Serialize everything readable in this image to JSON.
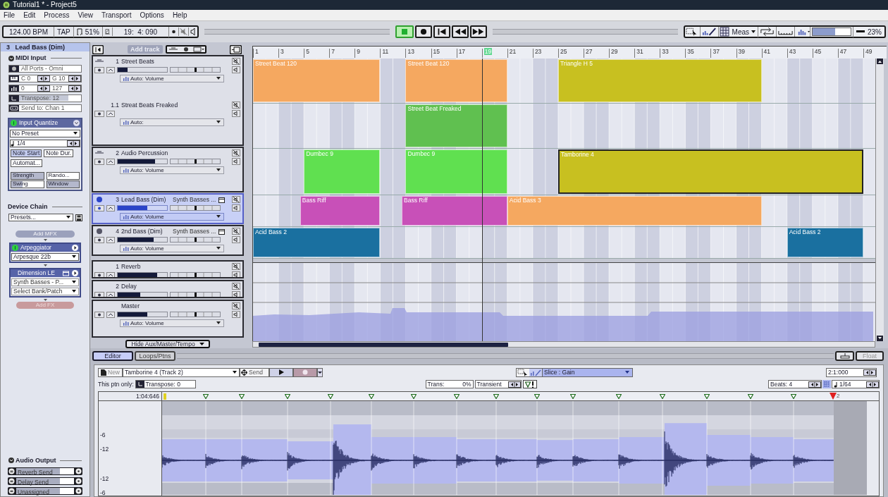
{
  "window": {
    "title": "Tutorial1 * - Project5"
  },
  "menu": [
    "File",
    "Edit",
    "Process",
    "View",
    "Transport",
    "Options",
    "Help"
  ],
  "transport": {
    "tempo": "124.00 BPM",
    "tap": "TAP",
    "swing": "51%",
    "position": "19:  4: 090",
    "buttons": [
      {
        "kind": "stop",
        "active": true
      },
      {
        "kind": "record",
        "active": false
      },
      {
        "kind": "to-start",
        "active": false
      },
      {
        "kind": "rewind",
        "active": false
      },
      {
        "kind": "forward",
        "active": false
      }
    ]
  },
  "tools": {
    "snap": "Meas",
    "zoom_slider": {
      "level": 0.6
    },
    "zoom": "23%"
  },
  "inspector": {
    "track_title": "3   Lead Bass (Dim)",
    "midi_input": {
      "heading": "MIDI Input",
      "port": "All Ports - Omni",
      "key_low": "C 0",
      "key_high": "G 10",
      "vel_low": "0",
      "vel_high": "127",
      "transpose": "Transpose: 12",
      "send_to": "Send to: Chan 1"
    },
    "quantize": {
      "title": "Input Quantize",
      "preset": "No Preset",
      "grid": "1/4",
      "buttons": [
        {
          "label": "Note Start",
          "selected": true
        },
        {
          "label": "Note Dur.",
          "selected": false
        },
        {
          "label": "Automat...",
          "selected": false
        }
      ],
      "params": [
        {
          "label": "Strength",
          "level": 1
        },
        {
          "label": "Rando...",
          "level": 0
        },
        {
          "label": "Swing",
          "level": 0.35
        },
        {
          "label": "Window",
          "level": 1
        }
      ]
    },
    "device_chain": {
      "heading": "Device Chain",
      "presets": "Presets...",
      "add_mfx": "Add MFX",
      "devices": [
        {
          "kind": "mfx",
          "name": "Arpeggiator",
          "rows": [
            "Arpesque 22b"
          ]
        },
        {
          "kind": "synth",
          "name": "Dimension LE",
          "rows": [
            "Synth Basses - P...",
            "Select Bank/Patch"
          ]
        }
      ],
      "add_fx": "Add FX"
    },
    "audio_output": {
      "heading": "Audio Output",
      "sends": [
        {
          "label": "Reverb Send",
          "level": 0.75
        },
        {
          "label": "Delay Send",
          "level": 0.75
        },
        {
          "label": "Unassigned",
          "level": 0.75
        }
      ]
    }
  },
  "track_header": {
    "add_track": "Add track"
  },
  "ruler": [
    {
      "label": "1",
      "selected": false
    },
    {
      "label": "3",
      "selected": false
    },
    {
      "label": "5",
      "selected": false
    },
    {
      "label": "7",
      "selected": false
    },
    {
      "label": "9",
      "selected": false
    },
    {
      "label": "11",
      "selected": false
    },
    {
      "label": "13",
      "selected": false
    },
    {
      "label": "15",
      "selected": false
    },
    {
      "label": "17",
      "selected": false
    },
    {
      "label": "19",
      "selected": true
    },
    {
      "label": "21",
      "selected": false
    },
    {
      "label": "23",
      "selected": false
    },
    {
      "label": "25",
      "selected": false
    },
    {
      "label": "27",
      "selected": false
    },
    {
      "label": "29",
      "selected": false
    },
    {
      "label": "31",
      "selected": false
    },
    {
      "label": "33",
      "selected": false
    },
    {
      "label": "35",
      "selected": false
    },
    {
      "label": "37",
      "selected": false
    },
    {
      "label": "39",
      "selected": false
    },
    {
      "label": "41",
      "selected": false
    },
    {
      "label": "43",
      "selected": false
    },
    {
      "label": "45",
      "selected": false
    },
    {
      "label": "47",
      "selected": false
    },
    {
      "label": "49",
      "selected": false
    }
  ],
  "tracks": [
    {
      "kind": "audio",
      "number": "1",
      "name": "Street Beats",
      "level": 0.2,
      "automation": "Auto: Volume",
      "selected": false,
      "pan": {
        "level": 0.5
      },
      "clips": [
        {
          "name": "Street Beat 120",
          "color": "#f5a860",
          "selected": false
        },
        {
          "name": "Street Beat 120",
          "color": "#f5a860",
          "selected": false
        },
        {
          "name": "Triangle H 5",
          "color": "#c8c020",
          "selected": false
        }
      ]
    },
    {
      "kind": "sub",
      "number": "1.1",
      "name": "Streat Beats Freaked",
      "automation": "Auto:",
      "selected": false,
      "clips": [
        {
          "name": "Street Beat Freaked",
          "color": "#60c050",
          "selected": false
        }
      ]
    },
    {
      "kind": "audio",
      "number": "2",
      "name": "Audio Percussion",
      "level": 0.75,
      "automation": "Auto: Volume",
      "selected": false,
      "pan": {
        "level": 0.5
      },
      "clips": [
        {
          "name": "Dumbec 9",
          "color": "#60e050",
          "selected": false
        },
        {
          "name": "Dumbec 9",
          "color": "#60e050",
          "selected": false
        },
        {
          "name": "Tamborine 4",
          "color": "#c8c020",
          "selected": true
        }
      ]
    },
    {
      "kind": "instrument",
      "number": "3",
      "name": "Lead Bass (Dim)",
      "instrument": "Synth Basses ...",
      "level": 0.6,
      "automation": "Auto: Volume",
      "selected": true,
      "pan": {
        "level": 0.5
      },
      "clips": [
        {
          "name": "Bass Riff",
          "color": "#c850b8",
          "selected": false
        },
        {
          "name": "Bass Riff",
          "color": "#c850b8",
          "selected": false
        },
        {
          "name": "Acid Bass 3",
          "color": "#f5a860",
          "selected": false
        }
      ]
    },
    {
      "kind": "instrument",
      "number": "4",
      "name": "2nd Bass (Dim)",
      "instrument": "Synth Basses ...",
      "level": 0.73,
      "automation": "Auto: Volume",
      "selected": false,
      "pan": {
        "level": 0.5
      },
      "clips": [
        {
          "name": "Acid Bass 2",
          "color": "#1a70a0",
          "selected": false
        },
        {
          "name": "Acid Bass 2",
          "color": "#1a70a0",
          "selected": false
        }
      ]
    }
  ],
  "aux_tracks": [
    {
      "number": "1",
      "name": "Reverb",
      "level": 0.8,
      "pan": {
        "level": 0.5
      }
    },
    {
      "number": "2",
      "name": "Delay",
      "level": 0.45,
      "pan": {
        "level": 0.5
      }
    },
    {
      "name": "Master",
      "level": 0.6,
      "pan": {
        "level": 0.5
      },
      "automation": "Auto: Volume"
    }
  ],
  "hide_aux": "Hide Aux/Master/Tempo",
  "editor": {
    "tabs": [
      {
        "label": "Editor",
        "selected": true
      },
      {
        "label": "Loops/Ptns",
        "selected": false
      }
    ],
    "float": "Float",
    "new": "New",
    "pattern": "Tamborine 4 (Track 2)",
    "send": "Send",
    "slice_mode": "Slice : Gain",
    "locator": "2:1:000",
    "ptn_only": "This ptn only:",
    "transpose": "Transpose: 0",
    "trans_label": "Trans:",
    "trans_value": "0%",
    "transient": "Transient",
    "beats": "Beats: 4",
    "grid": "1/64",
    "time": "1:04:646",
    "end_label": "2",
    "scale": [
      "-6",
      "-12",
      "-12",
      "-6"
    ]
  }
}
